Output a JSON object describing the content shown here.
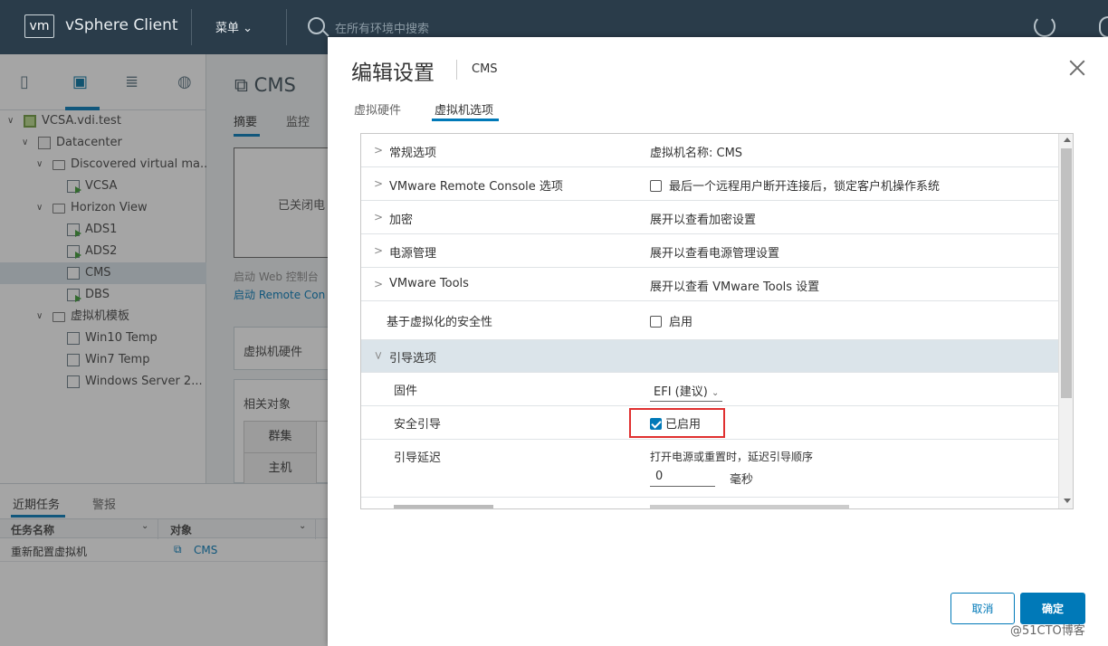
{
  "header": {
    "logo": "vm",
    "brand": "vSphere Client",
    "menu": "菜单",
    "search_placeholder": "在所有环境中搜索"
  },
  "nav": {
    "icons": [
      "hosts-icon",
      "vms-icon",
      "storage-icon",
      "network-icon"
    ],
    "tree": [
      {
        "label": "VCSA.vdi.test",
        "level": 0,
        "icon": "vcenter-icon",
        "expanded": true
      },
      {
        "label": "Datacenter",
        "level": 1,
        "icon": "datacenter-icon",
        "expanded": true
      },
      {
        "label": "Discovered virtual ma...",
        "level": 2,
        "icon": "folder-icon",
        "expanded": true
      },
      {
        "label": "VCSA",
        "level": 3,
        "icon": "vm-on-icon"
      },
      {
        "label": "Horizon View",
        "level": 2,
        "icon": "folder-icon",
        "expanded": true
      },
      {
        "label": "ADS1",
        "level": 3,
        "icon": "vm-on-icon"
      },
      {
        "label": "ADS2",
        "level": 3,
        "icon": "vm-on-icon"
      },
      {
        "label": "CMS",
        "level": 3,
        "icon": "vm-off-icon",
        "selected": true
      },
      {
        "label": "DBS",
        "level": 3,
        "icon": "vm-on-icon"
      },
      {
        "label": "虚拟机模板",
        "level": 2,
        "icon": "folder-icon",
        "expanded": true
      },
      {
        "label": "Win10 Temp",
        "level": 3,
        "icon": "template-icon"
      },
      {
        "label": "Win7 Temp",
        "level": 3,
        "icon": "template-icon"
      },
      {
        "label": "Windows Server 2...",
        "level": 3,
        "icon": "template-icon"
      }
    ]
  },
  "main": {
    "title": "CMS",
    "tabs": [
      "摘要",
      "监控"
    ],
    "powered_off": "已关闭电",
    "web_console": "启动 Web 控制台",
    "remote_console": "启动 Remote Con",
    "vm_hardware": "虚拟机硬件",
    "related": "相关对象",
    "cluster": "群集",
    "host": "主机"
  },
  "tasks": {
    "tabs": [
      "近期任务",
      "警报"
    ],
    "col_task": "任务名称",
    "col_target": "对象",
    "row_task": "重新配置虚拟机",
    "row_target": "CMS"
  },
  "modal": {
    "title": "编辑设置",
    "subtitle": "CMS",
    "tabs": [
      "虚拟硬件",
      "虚拟机选项"
    ],
    "rows": {
      "general": {
        "label": "常规选项",
        "value": "虚拟机名称: CMS"
      },
      "vmrc": {
        "label": "VMware Remote Console 选项",
        "value": "最后一个远程用户断开连接后，锁定客户机操作系统"
      },
      "encryption": {
        "label": "加密",
        "value": "展开以查看加密设置"
      },
      "power": {
        "label": "电源管理",
        "value": "展开以查看电源管理设置"
      },
      "tools": {
        "label": "VMware Tools",
        "value": "展开以查看 VMware Tools 设置"
      },
      "vbs": {
        "label": "基于虚拟化的安全性",
        "value": "启用"
      },
      "boot": {
        "label": "引导选项"
      },
      "firmware": {
        "label": "固件",
        "value": "EFI (建议)"
      },
      "secureboot": {
        "label": "安全引导",
        "value": "已启用",
        "checked": true
      },
      "bootdelay": {
        "label": "引导延迟",
        "desc": "打开电源或重置时，延迟引导顺序",
        "value": "0",
        "unit": "毫秒"
      }
    },
    "cancel": "取消",
    "ok": "确定"
  },
  "watermark": "@51CTO博客"
}
